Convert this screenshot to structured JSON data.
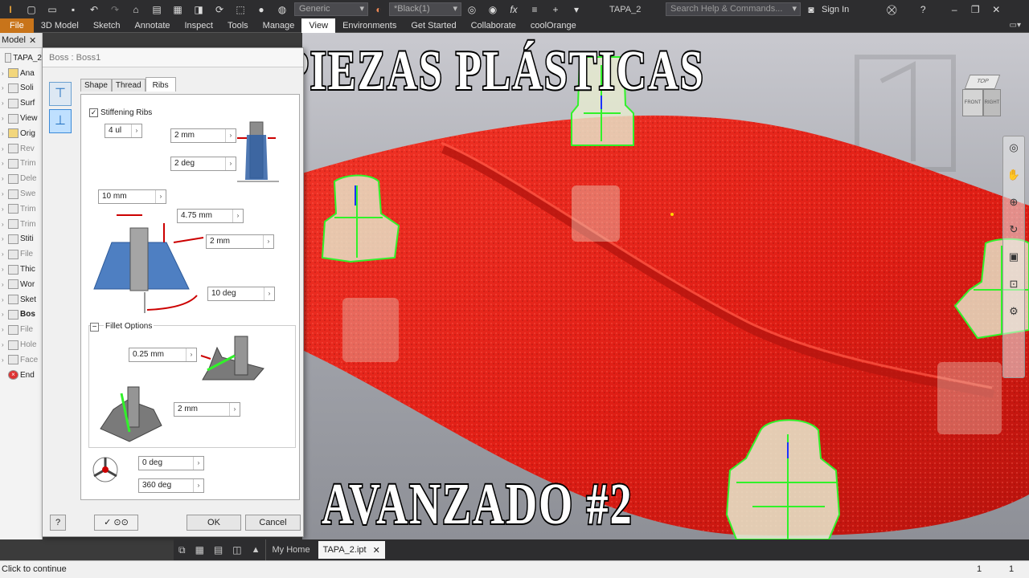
{
  "toolbar": {
    "appearance_combo": "Generic",
    "color_combo": "*Black(1)",
    "file_name": "TAPA_2",
    "search_placeholder": "Search Help & Commands...",
    "sign_in": "Sign In"
  },
  "ribbon": {
    "tabs": [
      "File",
      "3D Model",
      "Sketch",
      "Annotate",
      "Inspect",
      "Tools",
      "Manage",
      "View",
      "Environments",
      "Get Started",
      "Collaborate",
      "coolOrange"
    ],
    "active_tab": "View"
  },
  "browser": {
    "tab_label": "Model",
    "items": [
      {
        "label": "TAPA_2"
      },
      {
        "label": "Ana"
      },
      {
        "label": "Soli"
      },
      {
        "label": "Surf"
      },
      {
        "label": "View"
      },
      {
        "label": "Orig"
      },
      {
        "label": "Rev"
      },
      {
        "label": "Trim"
      },
      {
        "label": "Dele"
      },
      {
        "label": "Swe"
      },
      {
        "label": "Trim"
      },
      {
        "label": "Trim"
      },
      {
        "label": "Stiti"
      },
      {
        "label": "File"
      },
      {
        "label": "Thic"
      },
      {
        "label": "Wor"
      },
      {
        "label": "Sket"
      },
      {
        "label": "Bos"
      },
      {
        "label": "File"
      },
      {
        "label": "Hole"
      },
      {
        "label": "Face"
      },
      {
        "label": "End"
      }
    ]
  },
  "dialog": {
    "title": "Boss : Boss1",
    "tabs": [
      "Shape",
      "Thread",
      "Ribs"
    ],
    "active_tab": "Ribs",
    "stiffening_ribs_label": "Stiffening Ribs",
    "stiffening_ribs_checked": true,
    "rib_count": "4 ul",
    "rib_thickness": "2 mm",
    "rib_draft": "2 deg",
    "rib_start_dist": "10 mm",
    "rib_offset": "4.75 mm",
    "rib_top_height": "2 mm",
    "rib_taper": "10 deg",
    "fillet_options_label": "Fillet Options",
    "fillet_radius_1": "0.25 mm",
    "fillet_radius_2": "2 mm",
    "start_angle": "0 deg",
    "sweep_angle": "360 deg",
    "ok_label": "OK",
    "cancel_label": "Cancel"
  },
  "overlay": {
    "title_line": "PIEZAS PLÁSTICAS",
    "subtitle_line": "AVANZADO #2"
  },
  "viewcube": {
    "face_top": "TOP",
    "face_front": "FRONT",
    "face_right": "RIGHT"
  },
  "doc_tabs": {
    "home_label": "My Home",
    "doc_label": "TAPA_2.ipt"
  },
  "status": {
    "message": "Click to continue",
    "count_1": "1",
    "count_2": "1"
  },
  "colors": {
    "accent_file": "#c8741a",
    "part_red": "#e8261c",
    "boss_green": "#27e81f"
  }
}
